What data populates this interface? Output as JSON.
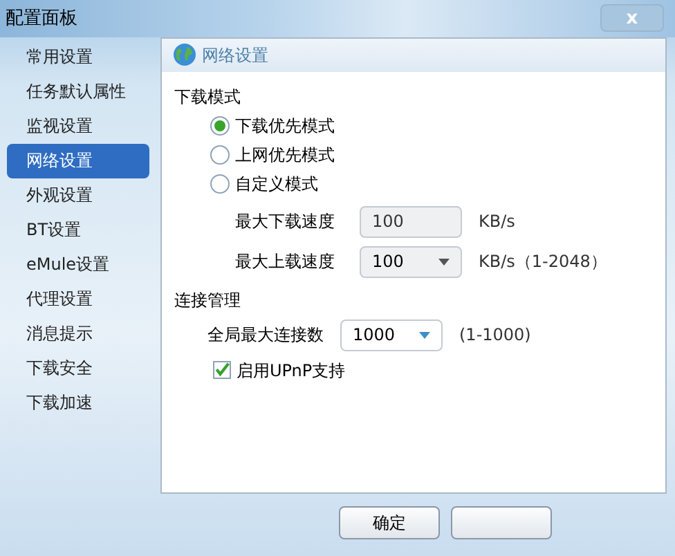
{
  "window": {
    "title": "配置面板",
    "close": "x"
  },
  "sidebar": {
    "items": [
      {
        "label": "常用设置",
        "selected": false
      },
      {
        "label": "任务默认属性",
        "selected": false
      },
      {
        "label": "监视设置",
        "selected": false
      },
      {
        "label": "网络设置",
        "selected": true
      },
      {
        "label": "外观设置",
        "selected": false
      },
      {
        "label": "BT设置",
        "selected": false
      },
      {
        "label": "eMule设置",
        "selected": false
      },
      {
        "label": "代理设置",
        "selected": false
      },
      {
        "label": "消息提示",
        "selected": false
      },
      {
        "label": "下载安全",
        "selected": false
      },
      {
        "label": "下载加速",
        "selected": false
      }
    ]
  },
  "panel": {
    "title": "网络设置",
    "download_mode": {
      "heading": "下载模式",
      "options": [
        {
          "label": "下载优先模式",
          "selected": true
        },
        {
          "label": "上网优先模式",
          "selected": false
        },
        {
          "label": "自定义模式",
          "selected": false
        }
      ],
      "fields": [
        {
          "kind": "input",
          "label": "最大下载速度",
          "value": "100",
          "unit": "KB/s",
          "disabled": true
        },
        {
          "kind": "dropdown",
          "label": "最大上载速度",
          "value": "100",
          "unit": "KB/s（1-2048）",
          "disabled": true
        }
      ]
    },
    "connection": {
      "heading": "连接管理",
      "fields": [
        {
          "kind": "dropdown",
          "label": "全局最大连接数",
          "value": "1000",
          "unit": "(1-1000)",
          "disabled": false
        }
      ],
      "upnp": {
        "label": "启用UPnP支持",
        "checked": true
      }
    }
  },
  "buttons": [
    {
      "kind": "text",
      "label": "确定"
    },
    {
      "kind": "blank"
    }
  ]
}
